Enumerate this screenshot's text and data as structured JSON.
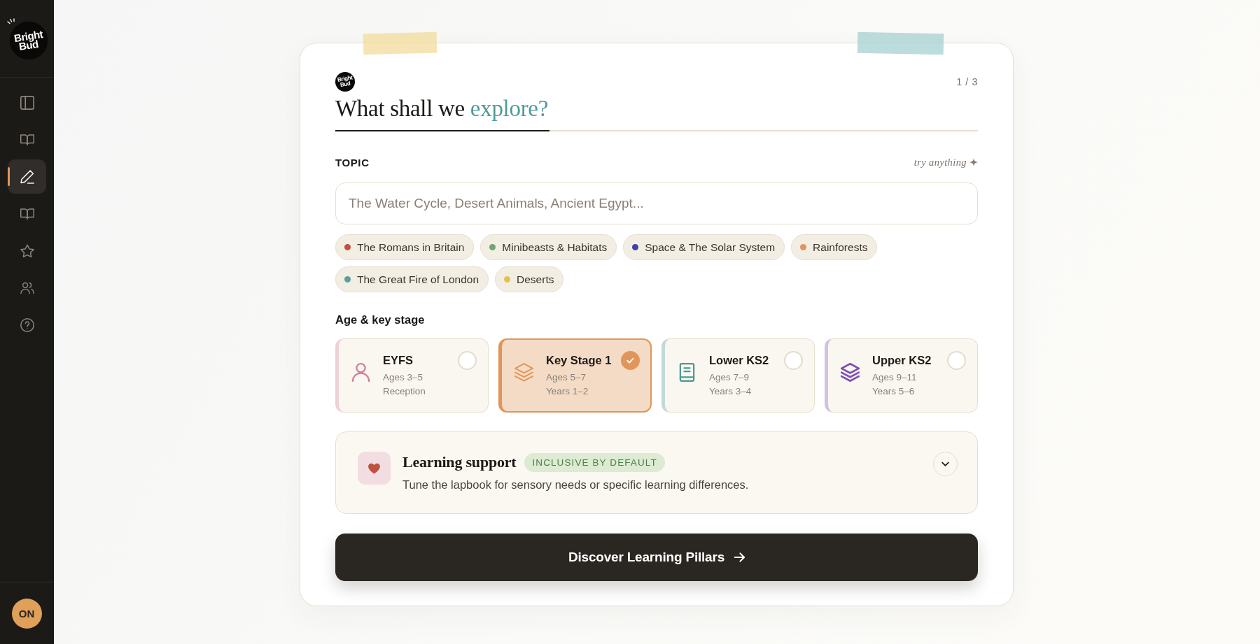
{
  "sidebar": {
    "logo": [
      "Bright",
      "Bud"
    ],
    "nav": [
      {
        "selected": false
      },
      {
        "selected": false
      },
      {
        "selected": true
      },
      {
        "selected": false
      },
      {
        "selected": false
      },
      {
        "selected": false
      },
      {
        "selected": false
      }
    ],
    "avatar": "ON"
  },
  "card": {
    "logo": [
      "Bright",
      "Bud"
    ],
    "step": "1 / 3",
    "title": {
      "text": "What shall we",
      "highlight": "explore?"
    },
    "progress": {
      "level": 0.333
    },
    "topic": {
      "label": "TOPIC",
      "hint": "try anything",
      "placeholder": "The Water Cycle, Desert Animals, Ancient Egypt..."
    },
    "suggestions": [
      {
        "label": "The Romans in Britain",
        "color": "#c0513f"
      },
      {
        "label": "Minibeasts & Habitats",
        "color": "#6fa576"
      },
      {
        "label": "Space & The Solar System",
        "color": "#3d45a0"
      },
      {
        "label": "Rainforests",
        "color": "#e0965a"
      },
      {
        "label": "The Great Fire of London",
        "color": "#5a9e9e"
      },
      {
        "label": "Deserts",
        "color": "#e6c04d"
      }
    ],
    "age": {
      "label": "Age & key stage",
      "options": [
        {
          "title": "EYFS",
          "details": [
            "Ages 3–5",
            "Reception"
          ],
          "color": "#d27d9c",
          "selected": false
        },
        {
          "title": "Key Stage 1",
          "details": [
            "Ages 5–7",
            "Years 1–2"
          ],
          "color": "#e0965a",
          "selected": true
        },
        {
          "title": "Lower KS2",
          "details": [
            "Ages 7–9",
            "Years 3–4"
          ],
          "color": "#4a9a94",
          "selected": false
        },
        {
          "title": "Upper KS2",
          "details": [
            "Ages 9–11",
            "Years 5–6"
          ],
          "color": "#7e4fb5",
          "selected": false
        }
      ]
    },
    "support": {
      "title": "Learning support",
      "badge": "INCLUSIVE BY DEFAULT",
      "description": "Tune the lapbook for sensory needs or specific learning differences.",
      "expanded": false
    },
    "action": {
      "label": "Discover Learning Pillars"
    }
  }
}
